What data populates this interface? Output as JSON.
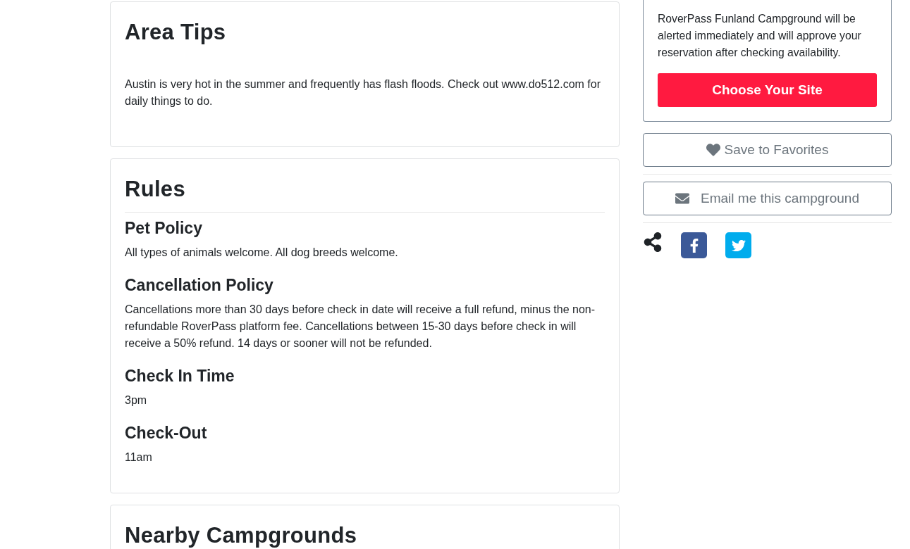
{
  "area_tips": {
    "title": "Area Tips",
    "text": "Austin is very hot in the summer and frequently has flash floods. Check out www.do512.com for daily things to do."
  },
  "rules": {
    "title": "Rules",
    "sections": [
      {
        "heading": "Pet Policy",
        "text": "All types of animals welcome. All dog breeds welcome."
      },
      {
        "heading": "Cancellation Policy",
        "text": "Cancellations more than 30 days before check in date will receive a full refund, minus the non-refundable RoverPass platform fee. Cancellations between 15-30 days before check in will receive a 50% refund. 14 days or sooner will not be refunded."
      },
      {
        "heading": "Check In Time",
        "text": "3pm"
      },
      {
        "heading": "Check-Out",
        "text": "11am"
      }
    ]
  },
  "nearby_campgrounds": {
    "title": "Nearby Campgrounds"
  },
  "booking_card": {
    "text": "RoverPass Funland Campground will be alerted immediately and will approve your reservation after checking availability.",
    "button": "Choose Your Site"
  },
  "actions": [
    {
      "kind": "favorite",
      "label": "Save to Favorites"
    },
    {
      "kind": "email",
      "label": "Email me this campground"
    }
  ]
}
